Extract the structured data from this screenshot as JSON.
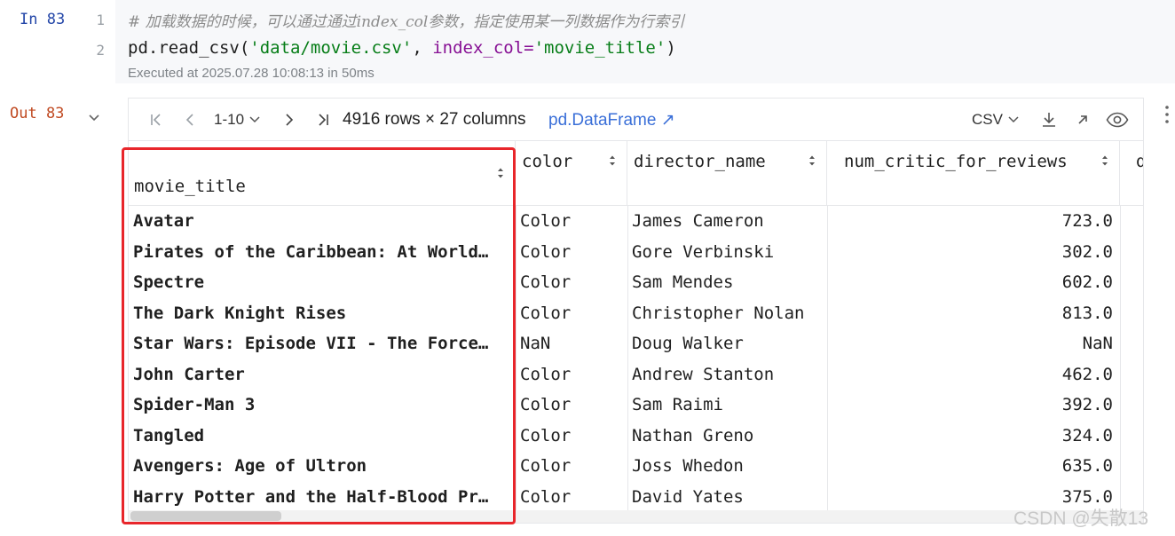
{
  "input_cell": {
    "label": "In 83",
    "line_numbers": [
      "1",
      "2"
    ],
    "comment": "# 加载数据的时候，可以通过通过index_col参数，指定使用某一列数据作为行索引",
    "code_tokens": {
      "func": "pd.read_csv(",
      "path": "'data/movie.csv'",
      "sep": ", ",
      "kw": "index_col=",
      "kw_val": "'movie_title'",
      "close": ")"
    },
    "executed": "Executed at 2025.07.28 10:08:13 in 50ms"
  },
  "output_cell": {
    "label": "Out 83",
    "toolbar": {
      "page_range": "1-10",
      "shape": "4916 rows × 27 columns",
      "type_link": "pd.DataFrame ↗",
      "export_format": "CSV"
    },
    "table": {
      "columns": {
        "index": "movie_title",
        "color": "color",
        "director": "director_name",
        "critic": "num_critic_for_reviews",
        "next_partial": "d"
      },
      "rows": [
        {
          "title": "Avatar",
          "color": "Color",
          "director": "James Cameron",
          "critic": "723.0"
        },
        {
          "title": "Pirates of the Caribbean: At World…",
          "color": "Color",
          "director": "Gore Verbinski",
          "critic": "302.0"
        },
        {
          "title": "Spectre",
          "color": "Color",
          "director": "Sam Mendes",
          "critic": "602.0"
        },
        {
          "title": "The Dark Knight Rises",
          "color": "Color",
          "director": "Christopher Nolan",
          "critic": "813.0"
        },
        {
          "title": "Star Wars: Episode VII - The Force…",
          "color": "NaN",
          "director": "Doug Walker",
          "critic": "NaN"
        },
        {
          "title": "John Carter",
          "color": "Color",
          "director": "Andrew Stanton",
          "critic": "462.0"
        },
        {
          "title": "Spider-Man 3",
          "color": "Color",
          "director": "Sam Raimi",
          "critic": "392.0"
        },
        {
          "title": "Tangled",
          "color": "Color",
          "director": "Nathan Greno",
          "critic": "324.0"
        },
        {
          "title": "Avengers: Age of Ultron",
          "color": "Color",
          "director": "Joss Whedon",
          "critic": "635.0"
        },
        {
          "title": "Harry Potter and the Half-Blood Pr…",
          "color": "Color",
          "director": "David Yates",
          "critic": "375.0"
        }
      ]
    }
  },
  "annotation": {
    "highlight_color": "#e8262b"
  },
  "watermark": "CSDN @失散13"
}
